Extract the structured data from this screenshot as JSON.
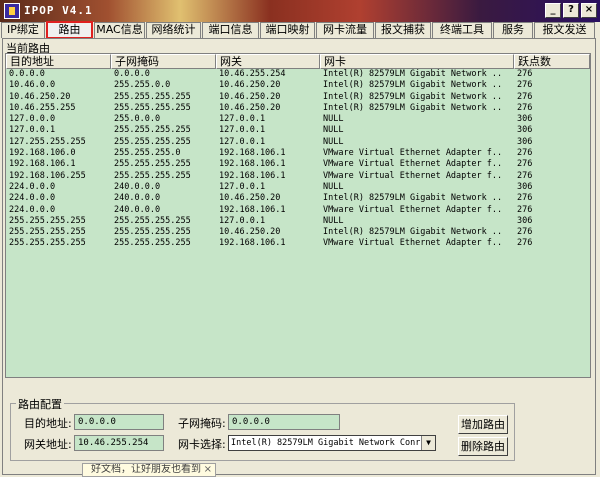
{
  "window": {
    "title": "IPOP V4.1",
    "controls": {
      "minimize": "_",
      "help": "?",
      "close": "×"
    }
  },
  "tabs": [
    "IP绑定",
    "路由",
    "MAC信息",
    "网络统计",
    "端口信息",
    "端口映射",
    "网卡流量",
    "报文捕获",
    "终端工具",
    "服务",
    "报文发送"
  ],
  "routes": {
    "group_title": "当前路由",
    "columns": [
      "目的地址",
      "子网掩码",
      "网关",
      "网卡",
      "跃点数"
    ],
    "rows": [
      [
        "0.0.0.0",
        "0.0.0.0",
        "10.46.255.254",
        "Intel(R) 82579LM Gigabit Network ..",
        "276"
      ],
      [
        "10.46.0.0",
        "255.255.0.0",
        "10.46.250.20",
        "Intel(R) 82579LM Gigabit Network ..",
        "276"
      ],
      [
        "10.46.250.20",
        "255.255.255.255",
        "10.46.250.20",
        "Intel(R) 82579LM Gigabit Network ..",
        "276"
      ],
      [
        "10.46.255.255",
        "255.255.255.255",
        "10.46.250.20",
        "Intel(R) 82579LM Gigabit Network ..",
        "276"
      ],
      [
        "127.0.0.0",
        "255.0.0.0",
        "127.0.0.1",
        "NULL",
        "306"
      ],
      [
        "127.0.0.1",
        "255.255.255.255",
        "127.0.0.1",
        "NULL",
        "306"
      ],
      [
        "127.255.255.255",
        "255.255.255.255",
        "127.0.0.1",
        "NULL",
        "306"
      ],
      [
        "192.168.106.0",
        "255.255.255.0",
        "192.168.106.1",
        "VMware Virtual Ethernet Adapter f..",
        "276"
      ],
      [
        "192.168.106.1",
        "255.255.255.255",
        "192.168.106.1",
        "VMware Virtual Ethernet Adapter f..",
        "276"
      ],
      [
        "192.168.106.255",
        "255.255.255.255",
        "192.168.106.1",
        "VMware Virtual Ethernet Adapter f..",
        "276"
      ],
      [
        "224.0.0.0",
        "240.0.0.0",
        "127.0.0.1",
        "NULL",
        "306"
      ],
      [
        "224.0.0.0",
        "240.0.0.0",
        "10.46.250.20",
        "Intel(R) 82579LM Gigabit Network ..",
        "276"
      ],
      [
        "224.0.0.0",
        "240.0.0.0",
        "192.168.106.1",
        "VMware Virtual Ethernet Adapter f..",
        "276"
      ],
      [
        "255.255.255.255",
        "255.255.255.255",
        "127.0.0.1",
        "NULL",
        "306"
      ],
      [
        "255.255.255.255",
        "255.255.255.255",
        "10.46.250.20",
        "Intel(R) 82579LM Gigabit Network ..",
        "276"
      ],
      [
        "255.255.255.255",
        "255.255.255.255",
        "192.168.106.1",
        "VMware Virtual Ethernet Adapter f..",
        "276"
      ]
    ]
  },
  "config": {
    "title": "路由配置",
    "dest_label": "目的地址:",
    "dest_value": "0.0.0.0",
    "mask_label": "子网掩码:",
    "mask_value": "0.0.0.0",
    "gateway_label": "网关地址:",
    "gateway_value": "10.46.255.254",
    "nic_label": "网卡选择:",
    "nic_value": "Intel(R) 82579LM Gigabit Network Conr",
    "add_button": "增加路由",
    "delete_button": "删除路由"
  },
  "status": {
    "text": "好文档，让好朋友也看到",
    "close": "×"
  },
  "colors": {
    "list_bg": "#c6e5c8",
    "active_tab_border": "#e02020",
    "window_bg": "#ece9d8"
  }
}
